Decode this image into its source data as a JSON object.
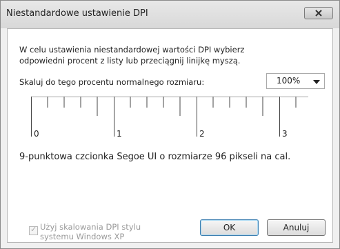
{
  "window": {
    "title": "Niestandardowe ustawienie DPI"
  },
  "dialog": {
    "description_line1": "W celu ustawienia niestandardowej wartości DPI wybierz",
    "description_line2": "odpowiedni procent z listy lub przeciągnij linijkę myszą.",
    "scale_label": "Skaluj do tego procentu normalnego rozmiaru:",
    "scale_value": "100%",
    "ruler_labels": [
      "0",
      "1",
      "2",
      "3"
    ],
    "sample_text": "9-punktowa czcionka Segoe UI o rozmiarze 96 pikseli na cal.",
    "xp_checkbox_line1": "Użyj skalowania DPI stylu",
    "xp_checkbox_line2": "systemu Windows XP",
    "xp_checked": true,
    "ok_label": "OK",
    "cancel_label": "Anuluj"
  }
}
